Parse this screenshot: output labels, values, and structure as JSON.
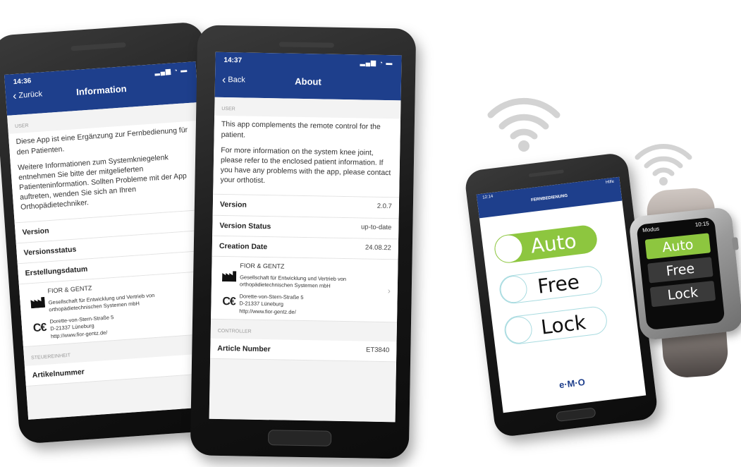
{
  "phone_left": {
    "time": "14:36",
    "back_label": "Zurück",
    "title": "Information",
    "section_user": "USER",
    "para1": "Diese App ist eine Ergänzung zur Fernbedienung für den Patienten.",
    "para2": "Weitere Informationen zum Systemkniegelenk entnehmen Sie bitte der mitgelieferten Patienteninformation. Sollten Probleme mit der App auftreten, wenden Sie sich an Ihren Orthopädietechniker.",
    "rows": [
      {
        "label": "Version",
        "value": ""
      },
      {
        "label": "Versionsstatus",
        "value": ""
      },
      {
        "label": "Erstellungsdatum",
        "value": ""
      }
    ],
    "manufacturer": {
      "name": "FIOR & GENTZ",
      "line1": "Gesellschaft für Entwicklung und Vertrieb von orthopädietechnischen Systemen mbH",
      "street": "Dorette-von-Stern-Straße 5",
      "city": "D-21337 Lüneburg",
      "url": "http://www.fior-gentz.de/"
    },
    "section_controller": "STEUEREINHEIT",
    "article_label": "Artikelnummer"
  },
  "phone_mid": {
    "time": "14:37",
    "back_label": "Back",
    "title": "About",
    "section_user": "USER",
    "para1": "This app complements the remote control for the patient.",
    "para2": "For more information on the system knee joint, please refer to the enclosed patient information. If you have any problems with the app, please contact your orthotist.",
    "rows": [
      {
        "label": "Version",
        "value": "2.0.7"
      },
      {
        "label": "Version Status",
        "value": "up-to-date"
      },
      {
        "label": "Creation Date",
        "value": "24.08.22"
      }
    ],
    "manufacturer": {
      "name": "FIOR & GENTZ",
      "line1": "Gesellschaft für Entwicklung und Vertrieb von orthopädietechnischen Systemen mbH",
      "street": "Dorette-von-Stern-Straße 5",
      "city": "D-21337 Lüneburg",
      "url": "http://www.fior-gentz.de/"
    },
    "section_controller": "CONTROLLER",
    "article_label": "Article Number",
    "article_value": "ET3840"
  },
  "phone_right": {
    "time": "12:14",
    "header_title": "FERNBEDIENUNG",
    "header_right": "Hilfe",
    "modes": [
      "Auto",
      "Free",
      "Lock"
    ],
    "active_mode": "Auto",
    "logo_text": "e·M·O"
  },
  "watch": {
    "title": "Modus",
    "time": "10:15",
    "modes": [
      "Auto",
      "Free",
      "Lock"
    ],
    "active_mode": "Auto"
  },
  "colors": {
    "header_blue": "#1e3f8c",
    "active_green": "#8dc63f",
    "toggle_outline": "#a8dbe0"
  }
}
